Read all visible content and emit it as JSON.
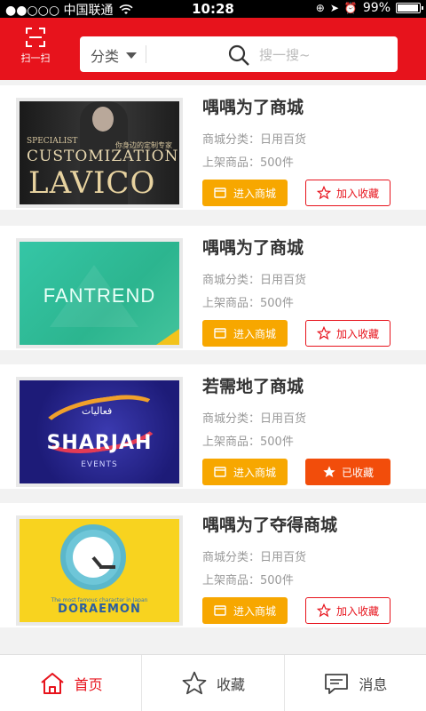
{
  "status_bar": {
    "carrier": "●●○○○ 中国联通",
    "time": "10:28",
    "battery": "99%"
  },
  "header": {
    "scan_label": "扫一扫",
    "category_label": "分类",
    "search_placeholder": "搜一搜~"
  },
  "shops": [
    {
      "name": "喁喁为了商城",
      "category": "商城分类：日用百货",
      "count": "上架商品：500件",
      "enter_label": "进入商城",
      "fav_label": "加入收藏",
      "favorited": false,
      "image": {
        "top": "SPECIALIST",
        "mid": "CUSTOMIZATION",
        "brand": "LAVICO",
        "tagline": "你身边的定制专家"
      }
    },
    {
      "name": "喁喁为了商城",
      "category": "商城分类：日用百货",
      "count": "上架商品：500件",
      "enter_label": "进入商城",
      "fav_label": "加入收藏",
      "favorited": false,
      "image": {
        "brand": "FANTREND"
      }
    },
    {
      "name": "若需地了商城",
      "category": "商城分类：日用百货",
      "count": "上架商品：500件",
      "enter_label": "进入商城",
      "fav_label": "已收藏",
      "favorited": true,
      "image": {
        "brand": "SHARJAH",
        "sub": "EVENTS",
        "arabic": "فعاليات"
      }
    },
    {
      "name": "喁喁为了夺得商城",
      "category": "商城分类：日用百货",
      "count": "上架商品：500件",
      "enter_label": "进入商城",
      "fav_label": "加入收藏",
      "favorited": false,
      "image": {
        "small": "The most famous character in Japan",
        "brand": "DORAEMON"
      }
    }
  ],
  "tabbar": {
    "home": "首页",
    "favorites": "收藏",
    "messages": "消息"
  },
  "colors": {
    "brand_red": "#e7131c",
    "enter_orange": "#f7a700",
    "favorited_orange": "#f24d0b"
  }
}
